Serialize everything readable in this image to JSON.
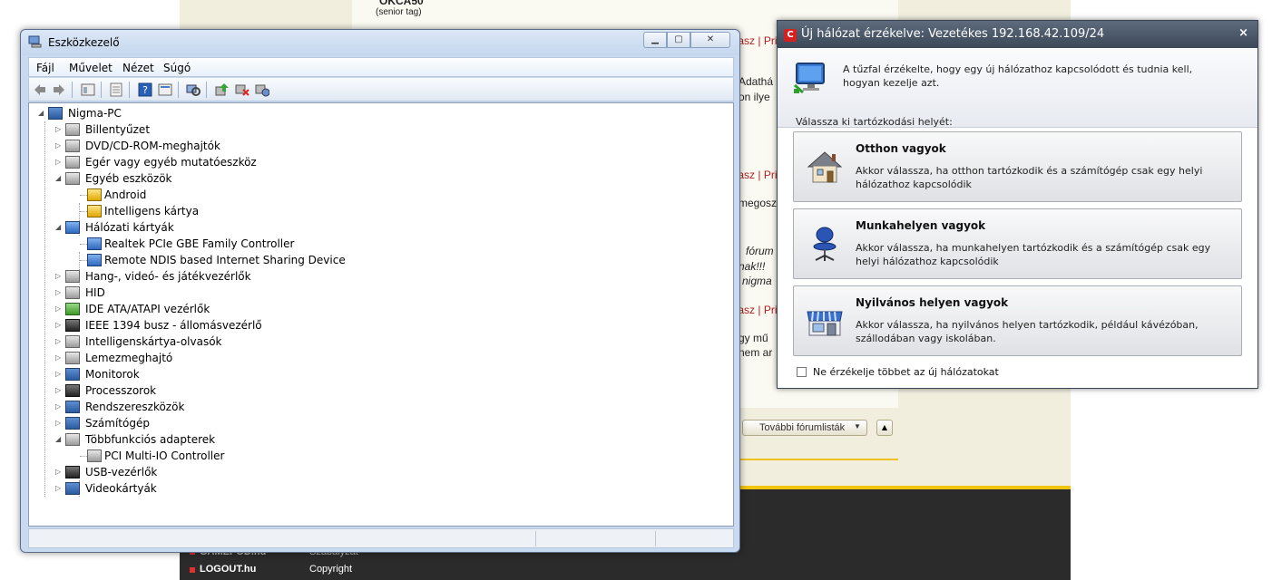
{
  "background_page": {
    "user_name": "OKCA50",
    "user_rank": "(senior tag)",
    "reply_label": "Válasz",
    "private_label": "Privát",
    "text_snippets": [
      "Adathá",
      "on ilye",
      "megosz",
      "fórum",
      "nak!!!",
      "nigma",
      "gy mű",
      "nem ar"
    ],
    "forum_lists_button": "További fórumlisták",
    "footer_links": [
      "GAMEPOD.hu",
      "LOGOUT.hu"
    ],
    "footer_links_right": [
      "Szabályzat",
      "Copyright"
    ]
  },
  "device_manager": {
    "title": "Eszközkezelő",
    "menu": [
      "Fájl",
      "Művelet",
      "Nézet",
      "Súgó"
    ],
    "tree": [
      {
        "label": "Nigma-PC",
        "depth": 0,
        "expanded": true,
        "icon": "computer-icon"
      },
      {
        "label": "Billentyűzet",
        "depth": 1,
        "expanded": false,
        "icon": "keyboard-icon"
      },
      {
        "label": "DVD/CD-ROM-meghajtók",
        "depth": 1,
        "expanded": false,
        "icon": "dvd-drive-icon"
      },
      {
        "label": "Egér vagy egyéb mutatóeszköz",
        "depth": 1,
        "expanded": false,
        "icon": "mouse-icon"
      },
      {
        "label": "Egyéb eszközök",
        "depth": 1,
        "expanded": true,
        "icon": "unknown-device-icon"
      },
      {
        "label": "Android",
        "depth": 2,
        "icon": "warning-device-icon"
      },
      {
        "label": "Intelligens kártya",
        "depth": 2,
        "icon": "warning-device-icon"
      },
      {
        "label": "Hálózati kártyák",
        "depth": 1,
        "expanded": true,
        "icon": "network-adapter-icon"
      },
      {
        "label": "Realtek PCIe GBE Family Controller",
        "depth": 2,
        "icon": "network-card-icon"
      },
      {
        "label": "Remote NDIS based Internet Sharing Device",
        "depth": 2,
        "icon": "network-card-icon"
      },
      {
        "label": "Hang-, videó- és játékvezérlők",
        "depth": 1,
        "expanded": false,
        "icon": "speaker-icon"
      },
      {
        "label": "HID",
        "depth": 1,
        "expanded": false,
        "icon": "hid-icon"
      },
      {
        "label": "IDE ATA/ATAPI vezérlők",
        "depth": 1,
        "expanded": false,
        "icon": "ide-controller-icon"
      },
      {
        "label": "IEEE 1394 busz - állomásvezérlő",
        "depth": 1,
        "expanded": false,
        "icon": "firewire-icon"
      },
      {
        "label": "Intelligenskártya-olvasók",
        "depth": 1,
        "expanded": false,
        "icon": "smartcard-reader-icon"
      },
      {
        "label": "Lemezmeghajtó",
        "depth": 1,
        "expanded": false,
        "icon": "disk-drive-icon"
      },
      {
        "label": "Monitorok",
        "depth": 1,
        "expanded": false,
        "icon": "monitor-icon"
      },
      {
        "label": "Processzorok",
        "depth": 1,
        "expanded": false,
        "icon": "processor-icon"
      },
      {
        "label": "Rendszereszközök",
        "depth": 1,
        "expanded": false,
        "icon": "system-devices-icon"
      },
      {
        "label": "Számítógép",
        "depth": 1,
        "expanded": false,
        "icon": "computer-icon"
      },
      {
        "label": "Többfunkciós adapterek",
        "depth": 1,
        "expanded": true,
        "icon": "multifunction-adapter-icon"
      },
      {
        "label": "PCI Multi-IO Controller",
        "depth": 2,
        "icon": "pci-device-icon"
      },
      {
        "label": "USB-vezérlők",
        "depth": 1,
        "expanded": false,
        "icon": "usb-icon"
      },
      {
        "label": "Videokártyák",
        "depth": 1,
        "expanded": false,
        "icon": "display-adapter-icon"
      }
    ]
  },
  "firewall_popup": {
    "title": "Új hálózat érzékelve: Vezetékes 192.168.42.109/24",
    "close_label": "×",
    "message": "A tűzfal érzékelte, hogy egy új hálózathoz kapcsolódott és tudnia kell, hogyan kezelje azt.",
    "prompt": "Válassza ki tartózkodási helyét:",
    "choices": [
      {
        "title": "Otthon vagyok",
        "description": "Akkor válassza, ha otthon tartózkodik és a számítógép csak egy helyi hálózathoz kapcsolódik",
        "icon": "house-icon"
      },
      {
        "title": "Munkahelyen vagyok",
        "description": "Akkor válassza, ha munkahelyen tartózkodik és a számítógép csak egy helyi hálózathoz kapcsolódik",
        "icon": "office-chair-icon"
      },
      {
        "title": "Nyilvános helyen vagyok",
        "description": "Akkor válassza, ha nyilvános helyen tartózkodik, például kávézóban, szállodában vagy iskolában.",
        "icon": "shop-icon"
      }
    ],
    "checkbox_label": "Ne érzékelje többet az új hálózatokat",
    "checkbox_checked": false
  }
}
